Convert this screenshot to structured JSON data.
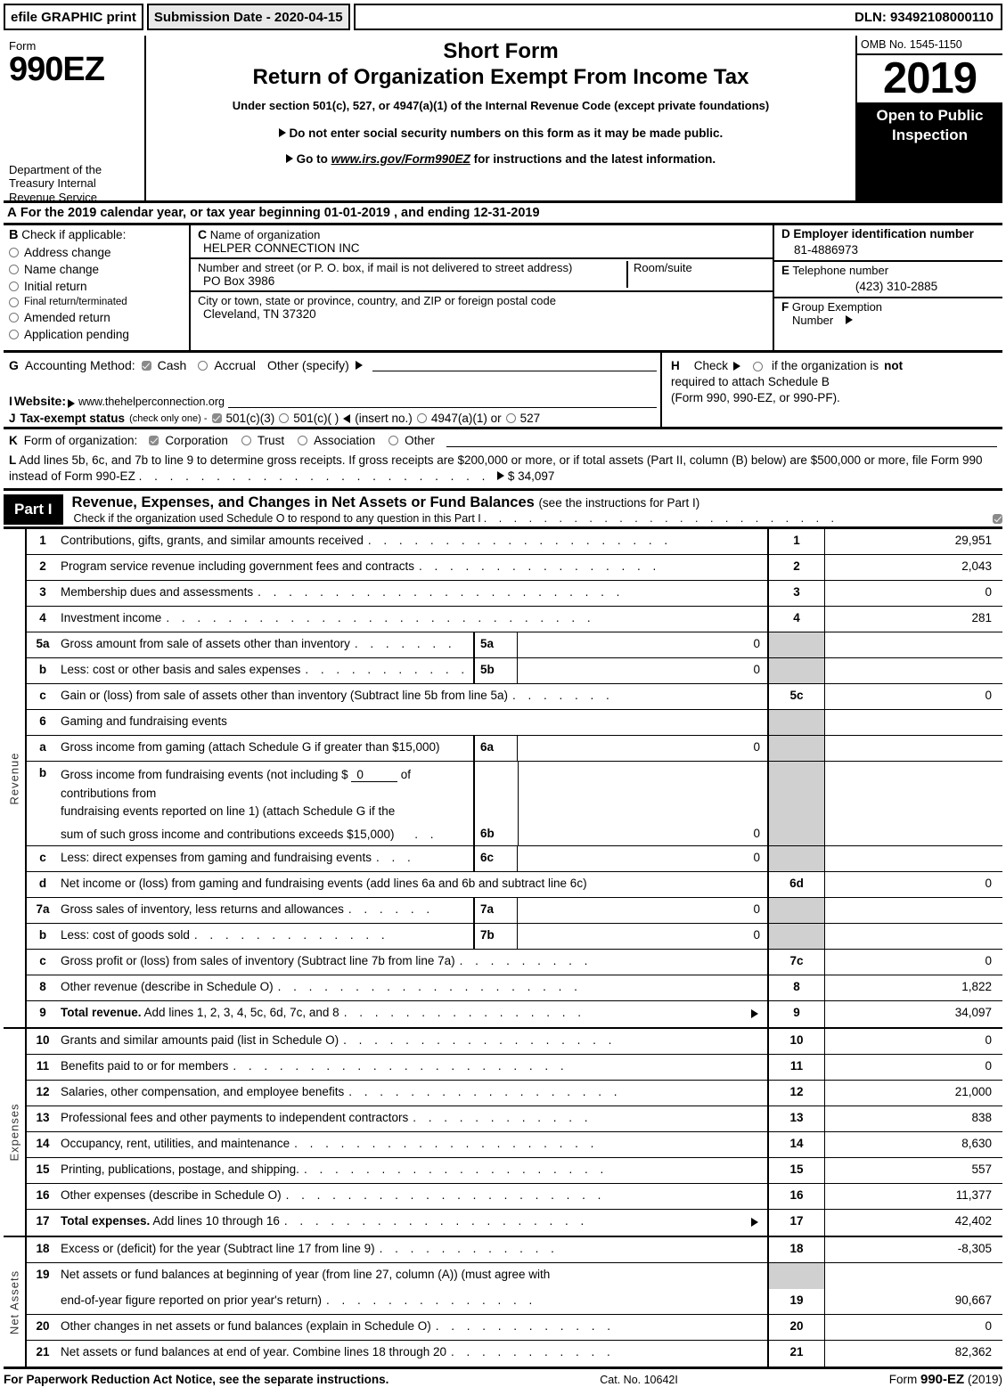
{
  "efile": {
    "graphic_print": "efile GRAPHIC print",
    "submission_date": "Submission Date - 2020-04-15",
    "dln": "DLN: 93492108000110"
  },
  "masthead": {
    "form_label": "Form",
    "form_number": "990EZ",
    "department": "Department of the Treasury Internal Revenue Service",
    "title_short": "Short Form",
    "title_main": "Return of Organization Exempt From Income Tax",
    "subtitle": "Under section 501(c), 527, or 4947(a)(1) of the Internal Revenue Code (except private foundations)",
    "notice_ssn": "Do not enter social security numbers on this form as it may be made public.",
    "notice_goto_prefix": "Go to",
    "notice_goto_link": "www.irs.gov/Form990EZ",
    "notice_goto_suffix": "for instructions and the latest information.",
    "omb": "OMB No. 1545-1150",
    "year": "2019",
    "open_to_public": "Open to Public Inspection"
  },
  "line_a": {
    "letter": "A",
    "text_before": "For the 2019 calendar year, or tax year beginning",
    "begin_date": "01-01-2019",
    "text_mid": ", and ending",
    "end_date": "12-31-2019"
  },
  "block_b": {
    "letter": "B",
    "heading": "Check if applicable:",
    "options": [
      {
        "label": "Address change",
        "checked": false
      },
      {
        "label": "Name change",
        "checked": false
      },
      {
        "label": "Initial return",
        "checked": false
      },
      {
        "label": "Final return/terminated",
        "checked": false
      },
      {
        "label": "Amended return",
        "checked": false
      },
      {
        "label": "Application pending",
        "checked": false
      }
    ]
  },
  "block_c": {
    "letter": "C",
    "name_caption": "Name of organization",
    "org_name": "HELPER CONNECTION INC",
    "street_caption": "Number and street (or P. O. box, if mail is not delivered to street address)",
    "room_caption": "Room/suite",
    "street_value": "PO Box 3986",
    "city_caption": "City or town, state or province, country, and ZIP or foreign postal code",
    "city_value": "Cleveland, TN   37320"
  },
  "block_d": {
    "ein_letter": "D",
    "ein_caption": "Employer identification number",
    "ein_value": "81-4886973",
    "tel_letter": "E",
    "tel_caption": "Telephone number",
    "tel_value": "(423) 310-2885",
    "grp_letter": "F",
    "grp_caption_1": "Group Exemption",
    "grp_caption_2": "Number"
  },
  "block_g": {
    "letter": "G",
    "label": "Accounting Method:",
    "cash": "Cash",
    "cash_checked": true,
    "accrual": "Accrual",
    "accrual_checked": false,
    "other": "Other (specify)"
  },
  "block_h": {
    "letter": "H",
    "check_label": "Check",
    "checked": false,
    "text_1_a": "if the organization is",
    "text_1_b": "not",
    "text_2": "required to attach Schedule B",
    "text_3": "(Form 990, 990-EZ, or 990-PF)."
  },
  "block_i": {
    "letter": "I",
    "label": "Website:",
    "value": "www.thehelperconnection.org"
  },
  "block_j": {
    "letter": "J",
    "label": "Tax-exempt status",
    "note": "(check only one) -",
    "opt_501c3": "501(c)(3)",
    "opt_501c3_checked": true,
    "opt_501c": "501(c)(    )",
    "opt_501c_checked": false,
    "insert_no": "(insert no.)",
    "opt_4947": "4947(a)(1) or",
    "opt_4947_checked": false,
    "opt_527": "527",
    "opt_527_checked": false
  },
  "block_k": {
    "letter": "K",
    "label": "Form of organization:",
    "options": [
      {
        "label": "Corporation",
        "checked": true
      },
      {
        "label": "Trust",
        "checked": false
      },
      {
        "label": "Association",
        "checked": false
      },
      {
        "label": "Other",
        "checked": false
      }
    ]
  },
  "block_l": {
    "letter": "L",
    "text": "Add lines 5b, 6c, and 7b to line 9 to determine gross receipts. If gross receipts are $200,000 or more, or if total assets (Part II, column (B) below) are $500,000 or more, file Form 990 instead of Form 990-EZ",
    "amount": "$ 34,097"
  },
  "part1": {
    "tag": "Part I",
    "title": "Revenue, Expenses, and Changes in Net Assets or Fund Balances",
    "title_note": "(see the instructions for Part I)",
    "schedule_o_text": "Check if the organization used Schedule O to respond to any question in this Part I",
    "schedule_o_checked": true
  },
  "sections": [
    {
      "vertical_label": "Revenue",
      "rows": [
        {
          "num": "1",
          "text": "Contributions, gifts, grants, and similar amounts received",
          "dots": true,
          "line_no": "1",
          "amount": "29,951"
        },
        {
          "num": "2",
          "text": "Program service revenue including government fees and contracts",
          "dots": true,
          "line_no": "2",
          "amount": "2,043"
        },
        {
          "num": "3",
          "text": "Membership dues and assessments",
          "dots": true,
          "line_no": "3",
          "amount": "0"
        },
        {
          "num": "4",
          "text": "Investment income",
          "dots": true,
          "line_no": "4",
          "amount": "281"
        },
        {
          "num": "5a",
          "text": "Gross amount from sale of assets other than inventory",
          "dots": true,
          "sub_no": "5a",
          "sub_amount": "0",
          "shaded": true
        },
        {
          "num": "b",
          "text": "Less: cost or other basis and sales expenses",
          "dots": true,
          "sub_no": "5b",
          "sub_amount": "0",
          "shaded": true
        },
        {
          "num": "c",
          "text": "Gain or (loss) from sale of assets other than inventory (Subtract line 5b from line 5a)",
          "dots": true,
          "line_no": "5c",
          "amount": "0"
        },
        {
          "num": "6",
          "text": "Gaming and fundraising events",
          "dots": false,
          "shaded": true,
          "blank_amount": true
        },
        {
          "num": "a",
          "text": "Gross income from gaming (attach Schedule G if greater than $15,000)",
          "dots": false,
          "sub_no": "6a",
          "sub_amount": "0",
          "shaded": true
        },
        {
          "num": "b",
          "multiline": [
            "Gross income from fundraising events (not including $ __0__ of contributions from",
            "fundraising events reported on line 1) (attach Schedule G if the",
            "sum of such gross income and contributions exceeds $15,000)"
          ],
          "inline_value": "0",
          "sub_no": "6b",
          "sub_amount": "0",
          "shaded": true
        },
        {
          "num": "c",
          "text": "Less: direct expenses from gaming and fundraising events",
          "dots": true,
          "sub_no": "6c",
          "sub_amount": "0",
          "shaded": true
        },
        {
          "num": "d",
          "text": "Net income or (loss) from gaming and fundraising events (add lines 6a and 6b and subtract line 6c)",
          "dots": false,
          "line_no": "6d",
          "amount": "0"
        },
        {
          "num": "7a",
          "text": "Gross sales of inventory, less returns and allowances",
          "dots": true,
          "sub_no": "7a",
          "sub_amount": "0",
          "shaded": true
        },
        {
          "num": "b",
          "text": "Less: cost of goods sold",
          "dots": true,
          "sub_no": "7b",
          "sub_amount": "0",
          "shaded": true
        },
        {
          "num": "c",
          "text": "Gross profit or (loss) from sales of inventory (Subtract line 7b from line 7a)",
          "dots": true,
          "line_no": "7c",
          "amount": "0"
        },
        {
          "num": "8",
          "text": "Other revenue (describe in Schedule O)",
          "dots": true,
          "line_no": "8",
          "amount": "1,822"
        },
        {
          "num": "9",
          "bold_prefix": "Total revenue.",
          "text": "Add lines 1, 2, 3, 4, 5c, 6d, 7c, and 8",
          "dots": true,
          "arrow": true,
          "line_no": "9",
          "amount": "34,097"
        }
      ]
    },
    {
      "vertical_label": "Expenses",
      "rows": [
        {
          "num": "10",
          "text": "Grants and similar amounts paid (list in Schedule O)",
          "dots": true,
          "line_no": "10",
          "amount": "0"
        },
        {
          "num": "11",
          "text": "Benefits paid to or for members",
          "dots": true,
          "line_no": "11",
          "amount": "0"
        },
        {
          "num": "12",
          "text": "Salaries, other compensation, and employee benefits",
          "dots": true,
          "line_no": "12",
          "amount": "21,000"
        },
        {
          "num": "13",
          "text": "Professional fees and other payments to independent contractors",
          "dots": true,
          "line_no": "13",
          "amount": "838"
        },
        {
          "num": "14",
          "text": "Occupancy, rent, utilities, and maintenance",
          "dots": true,
          "line_no": "14",
          "amount": "8,630"
        },
        {
          "num": "15",
          "text": "Printing, publications, postage, and shipping.",
          "dots": true,
          "line_no": "15",
          "amount": "557"
        },
        {
          "num": "16",
          "text": "Other expenses (describe in Schedule O)",
          "dots": true,
          "line_no": "16",
          "amount": "11,377"
        },
        {
          "num": "17",
          "bold_prefix": "Total expenses.",
          "text": "Add lines 10 through 16",
          "dots": true,
          "arrow": true,
          "line_no": "17",
          "amount": "42,402"
        }
      ]
    },
    {
      "vertical_label": "Net Assets",
      "rows": [
        {
          "num": "18",
          "text": "Excess or (deficit) for the year (Subtract line 17 from line 9)",
          "dots": true,
          "line_no": "18",
          "amount": "-8,305"
        },
        {
          "num": "19",
          "text": "Net assets or fund balances at beginning of year (from line 27, column (A)) (must agree with",
          "dots": false,
          "shaded": true,
          "blank_amount": true
        },
        {
          "num": "",
          "text": "end-of-year figure reported on prior year's return)",
          "dots": true,
          "line_no": "19",
          "amount": "90,667"
        },
        {
          "num": "20",
          "text": "Other changes in net assets or fund balances (explain in Schedule O)",
          "dots": true,
          "line_no": "20",
          "amount": "0"
        },
        {
          "num": "21",
          "text": "Net assets or fund balances at end of year. Combine lines 18 through 20",
          "dots": true,
          "line_no": "21",
          "amount": "82,362"
        }
      ]
    }
  ],
  "footer": {
    "left": "For Paperwork Reduction Act Notice, see the separate instructions.",
    "center": "Cat. No. 10642I",
    "right_prefix": "Form",
    "right_form": "990-EZ",
    "right_year": "(2019)"
  }
}
